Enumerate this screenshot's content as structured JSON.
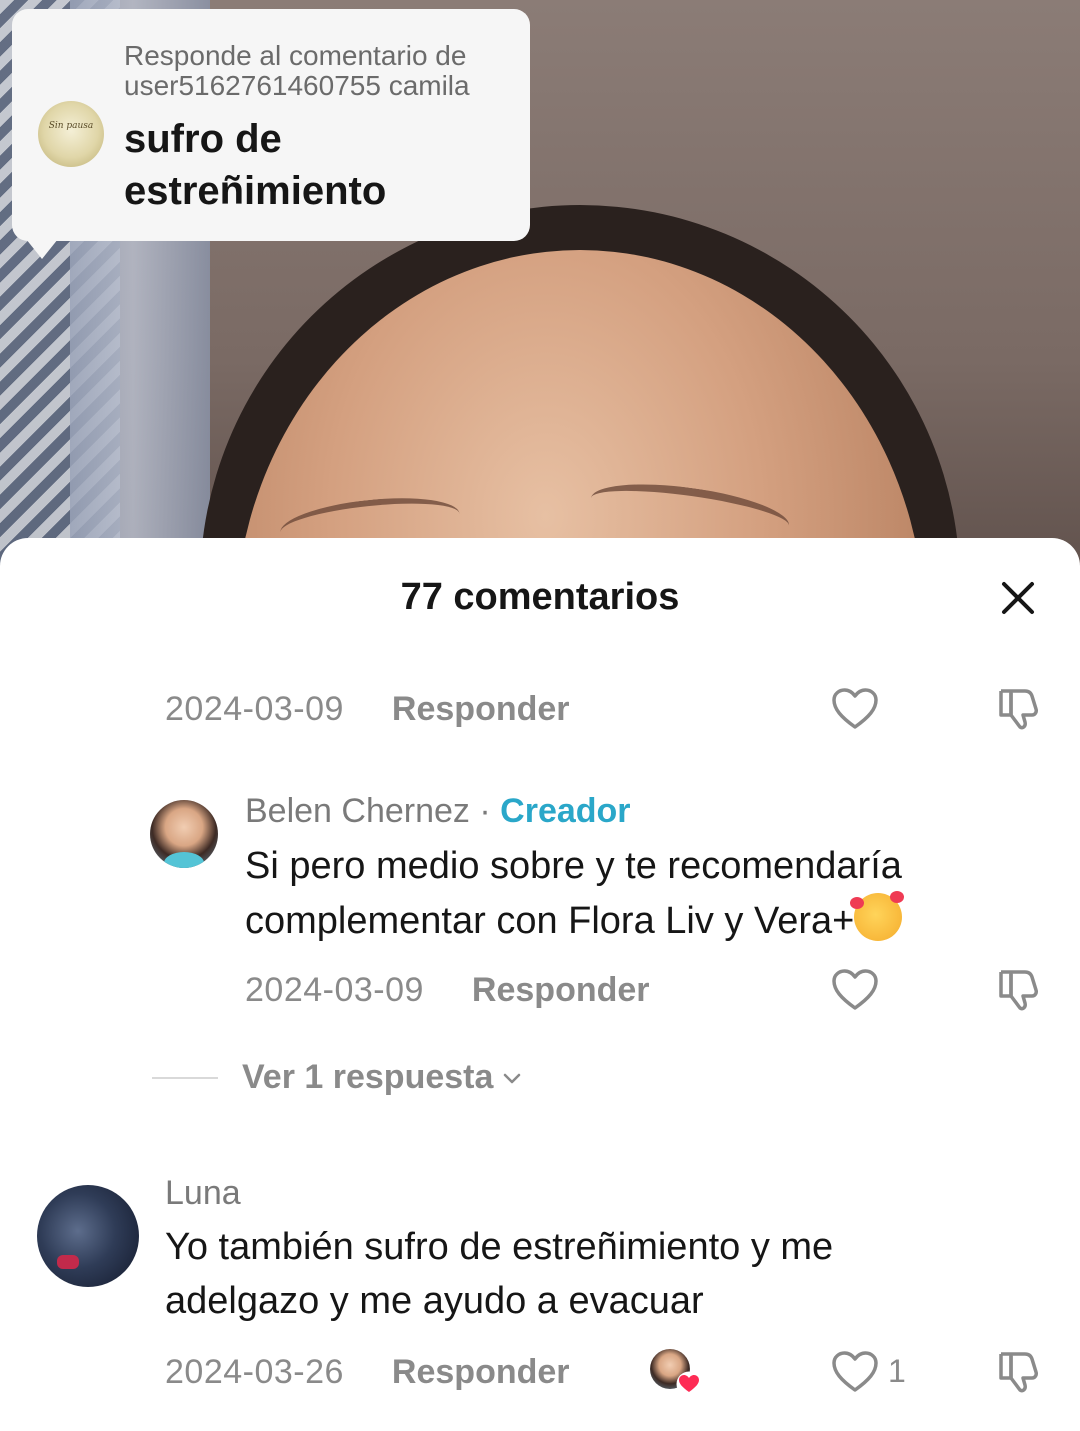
{
  "reply_sticker": {
    "header": "Responde al comentario de user5162761460755 camila",
    "comment": "sufro de estreñimiento"
  },
  "sheet": {
    "title": "77 comentarios"
  },
  "comments": [
    {
      "date": "2024-03-09",
      "reply_label": "Responder"
    },
    {
      "author": "Belen Chernez",
      "separator": "·",
      "badge": "Creador",
      "text": "Si pero medio sobre y te recomendaría complementar con Flora Liv y Vera+",
      "emoji": "smiling-face-with-hearts",
      "date": "2024-03-09",
      "reply_label": "Responder",
      "view_replies": "Ver 1 respuesta"
    },
    {
      "author": "Luna",
      "text": "Yo también sufro de estreñimiento y me adelgazo y me ayudo a evacuar",
      "date": "2024-03-26",
      "reply_label": "Responder",
      "likes": "1"
    }
  ],
  "icons": {
    "close": "close-icon",
    "like": "heart-outline-icon",
    "dislike": "thumbs-down-icon"
  },
  "colors": {
    "creator_badge": "#2aa7c9",
    "muted_text": "#8a8a8a",
    "primary_text": "#161616"
  }
}
